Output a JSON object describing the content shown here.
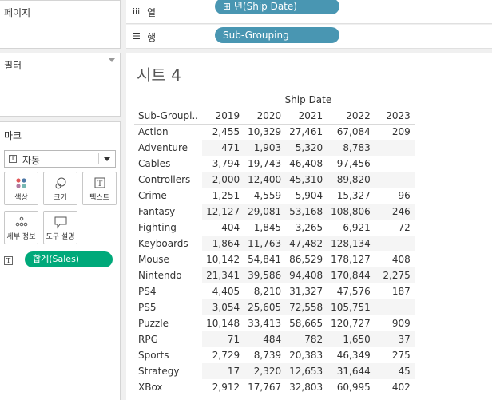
{
  "left_panel": {
    "pages_title": "페이지",
    "filters_title": "필터",
    "marks_title": "마크",
    "mark_type": "자동",
    "mark_buttons": [
      {
        "label": "색상",
        "icon": "color-icon"
      },
      {
        "label": "크기",
        "icon": "size-icon"
      },
      {
        "label": "텍스트",
        "icon": "text-icon"
      },
      {
        "label": "세부 정보",
        "icon": "detail-icon"
      },
      {
        "label": "도구 설명",
        "icon": "tooltip-icon"
      }
    ],
    "text_pill": "합계(Sales)",
    "text_pill_color": "#00a97a"
  },
  "shelves": {
    "columns_label": "열",
    "columns_pill": "⊞ 년(Ship Date)",
    "rows_label": "행",
    "rows_pill": "Sub-Grouping",
    "pill_color": "#4996b2"
  },
  "sheet": {
    "title": "시트 4",
    "column_group_header": "Ship Date",
    "row_header": "Sub-Groupi..",
    "years": [
      "2019",
      "2020",
      "2021",
      "2022",
      "2023"
    ],
    "rows": [
      {
        "name": "Action",
        "values": [
          "2,455",
          "10,329",
          "27,461",
          "67,084",
          "209"
        ]
      },
      {
        "name": "Adventure",
        "values": [
          "471",
          "1,903",
          "5,320",
          "8,783",
          ""
        ]
      },
      {
        "name": "Cables",
        "values": [
          "3,794",
          "19,743",
          "46,408",
          "97,456",
          ""
        ]
      },
      {
        "name": "Controllers",
        "values": [
          "2,000",
          "12,400",
          "45,310",
          "89,820",
          ""
        ]
      },
      {
        "name": "Crime",
        "values": [
          "1,251",
          "4,559",
          "5,904",
          "15,327",
          "96"
        ]
      },
      {
        "name": "Fantasy",
        "values": [
          "12,127",
          "29,081",
          "53,168",
          "108,806",
          "246"
        ]
      },
      {
        "name": "Fighting",
        "values": [
          "404",
          "1,845",
          "3,265",
          "6,921",
          "72"
        ]
      },
      {
        "name": "Keyboards",
        "values": [
          "1,864",
          "11,763",
          "47,482",
          "128,134",
          ""
        ]
      },
      {
        "name": "Mouse",
        "values": [
          "10,142",
          "54,841",
          "86,529",
          "178,127",
          "408"
        ]
      },
      {
        "name": "Nintendo",
        "values": [
          "21,341",
          "39,586",
          "94,408",
          "170,844",
          "2,275"
        ]
      },
      {
        "name": "PS4",
        "values": [
          "4,405",
          "8,210",
          "31,327",
          "47,576",
          "187"
        ]
      },
      {
        "name": "PS5",
        "values": [
          "3,054",
          "25,605",
          "72,558",
          "105,751",
          ""
        ]
      },
      {
        "name": "Puzzle",
        "values": [
          "10,148",
          "33,413",
          "58,665",
          "120,727",
          "909"
        ]
      },
      {
        "name": "RPG",
        "values": [
          "71",
          "484",
          "782",
          "1,650",
          "37"
        ]
      },
      {
        "name": "Sports",
        "values": [
          "2,729",
          "8,739",
          "20,383",
          "46,349",
          "275"
        ]
      },
      {
        "name": "Strategy",
        "values": [
          "17",
          "2,320",
          "12,653",
          "31,644",
          "45"
        ]
      },
      {
        "name": "XBox",
        "values": [
          "2,912",
          "17,767",
          "32,803",
          "60,995",
          "402"
        ]
      }
    ]
  }
}
